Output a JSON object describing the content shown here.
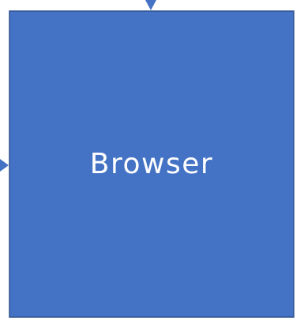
{
  "diagram": {
    "node": {
      "label": "Browser"
    },
    "colors": {
      "node_fill": "#4472c4",
      "node_border": "#2f528f",
      "arrow": "#4472c4",
      "background": "#ffffff"
    },
    "edges": [
      {
        "name": "incoming-arrow-top",
        "direction": "down"
      },
      {
        "name": "incoming-arrow-left",
        "direction": "right"
      }
    ]
  }
}
